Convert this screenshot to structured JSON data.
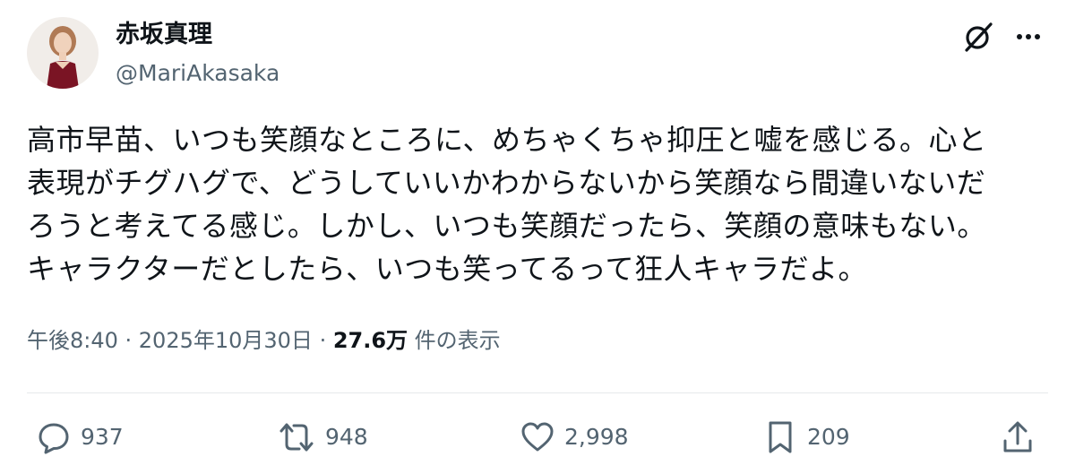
{
  "author": {
    "display_name": "赤坂真理",
    "handle": "@MariAkasaka"
  },
  "header_icons": [
    "grok-icon",
    "more-icon"
  ],
  "tweet": {
    "text": "高市早苗、いつも笑顔なところに、めちゃくちゃ抑圧と嘘を感じる。心と\n表現がチグハグで、どうしていいかわからないから笑顔なら間違いないだ\nろうと考えてる感じ。しかし、いつも笑顔だったら、笑顔の意味もない。\nキャラクターだとしたら、いつも笑ってるって狂人キャラだよ。"
  },
  "meta": {
    "timestamp": "午後8:40 · 2025年10月30日 · ",
    "views_count": "27.6万",
    "views_label": " 件の表示"
  },
  "actions": {
    "reply_count": "937",
    "repost_count": "948",
    "like_count": "2,998",
    "bookmark_count": "209"
  },
  "colors": {
    "text": "#0f1419",
    "secondary": "#536471",
    "divider": "#e6e9eb"
  }
}
